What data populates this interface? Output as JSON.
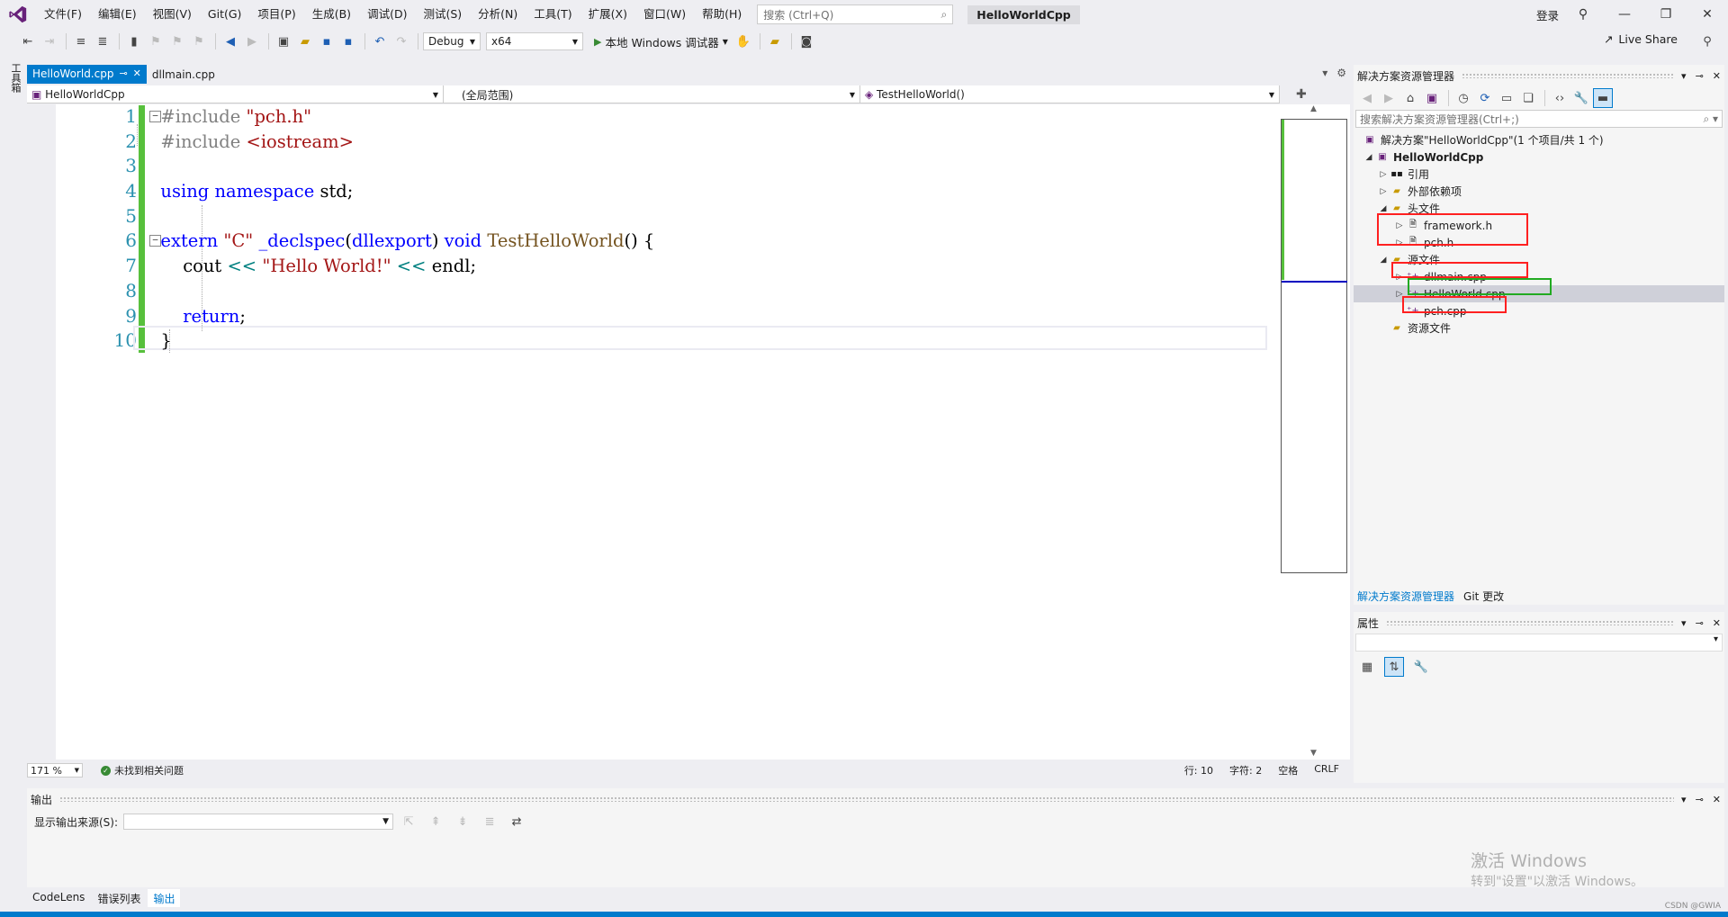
{
  "menu": {
    "items": [
      "文件(F)",
      "编辑(E)",
      "视图(V)",
      "Git(G)",
      "项目(P)",
      "生成(B)",
      "调试(D)",
      "测试(S)",
      "分析(N)",
      "工具(T)",
      "扩展(X)",
      "窗口(W)",
      "帮助(H)"
    ],
    "search_placeholder": "搜索 (Ctrl+Q)",
    "solution_name": "HelloWorldCpp",
    "login": "登录"
  },
  "toolbar": {
    "config": "Debug",
    "platform": "x64",
    "run_label": "本地 Windows 调试器",
    "live_share": "Live Share"
  },
  "toolbox_label": "工具箱",
  "tabs": {
    "active": "HelloWorld.cpp",
    "other": "dllmain.cpp"
  },
  "nav": {
    "project": "HelloWorldCpp",
    "scope": "(全局范围)",
    "member": "TestHelloWorld()"
  },
  "editor": {
    "line_numbers": [
      "1",
      "2",
      "3",
      "4",
      "5",
      "6",
      "7",
      "8",
      "9",
      "10"
    ],
    "code": {
      "l1_pp": "#include ",
      "l1_str": "\"pch.h\"",
      "l2_pp": "#include ",
      "l2_str": "<iostream>",
      "l4_kw1": "using",
      "l4_kw2": "namespace",
      "l4_rest": " std;",
      "l6_kw": "extern",
      "l6_str": "\"C\"",
      "l6_decl": "_declspec",
      "l6_arg": "dllexport",
      "l6_void": "void",
      "l6_fn": "TestHelloWorld",
      "l6_rest": "() {",
      "l7_cout": "cout",
      "l7_op1": "<<",
      "l7_str": "\"Hello World!\"",
      "l7_op2": "<<",
      "l7_endl": "endl",
      "l7_semi": ";",
      "l9_kw": "return",
      "l9_semi": ";",
      "l10": "}"
    }
  },
  "status": {
    "zoom": "171 %",
    "issues": "未找到相关问题",
    "line": "行: 10",
    "char": "字符: 2",
    "space": "空格",
    "eol": "CRLF"
  },
  "solution_explorer": {
    "title": "解决方案资源管理器",
    "search_placeholder": "搜索解决方案资源管理器(Ctrl+;)",
    "tree": {
      "solution": "解决方案\"HelloWorldCpp\"(1 个项目/共 1 个)",
      "project": "HelloWorldCpp",
      "refs": "引用",
      "external": "外部依赖项",
      "headers": "头文件",
      "framework_h": "framework.h",
      "pch_h": "pch.h",
      "sources": "源文件",
      "dllmain_cpp": "dllmain.cpp",
      "helloworld_cpp": "HelloWorld.cpp",
      "pch_cpp": "pch.cpp",
      "resources": "资源文件"
    },
    "tab_solution": "解决方案资源管理器",
    "tab_git": "Git 更改"
  },
  "properties": {
    "title": "属性"
  },
  "output": {
    "title": "输出",
    "source_label": "显示输出来源(S):",
    "watermark_1": "激活 Windows",
    "watermark_2": "转到\"设置\"以激活 Windows。"
  },
  "bottom_tabs": [
    "CodeLens",
    "错误列表",
    "输出"
  ],
  "credit": "CSDN @GWIA",
  "colors": {
    "accent": "#007acc",
    "change_bar": "#57c03c",
    "highlight_red": "#ff2020",
    "highlight_green": "#22aa22"
  }
}
